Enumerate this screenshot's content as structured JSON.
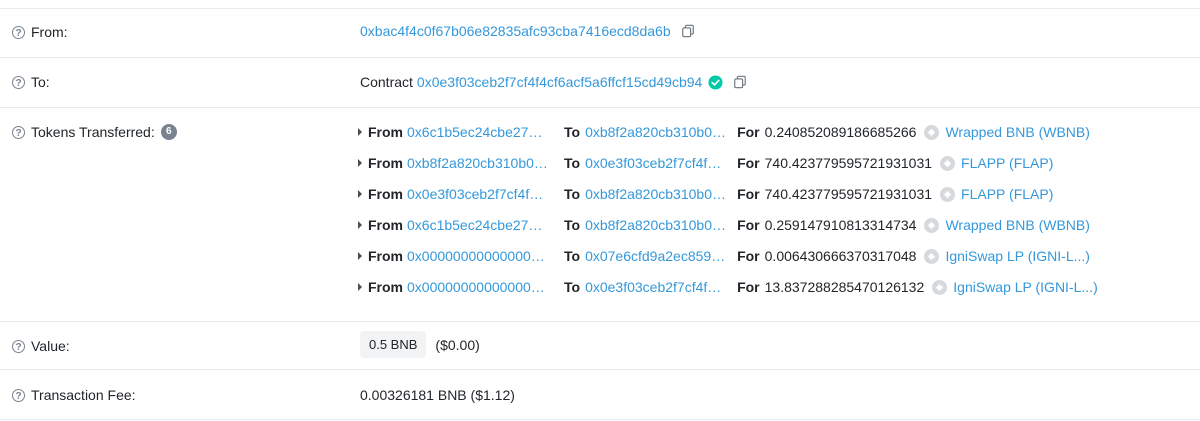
{
  "from": {
    "label": "From:",
    "address": "0xbac4f4c0f67b06e82835afc93cba7416ecd8da6b"
  },
  "to": {
    "label": "To:",
    "prefix": "Contract",
    "address": "0x0e3f03ceb2f7cf4f4cf6acf5a6ffcf15cd49cb94"
  },
  "tokens": {
    "label": "Tokens Transferred:",
    "count": "6",
    "kw_from": "From",
    "kw_to": "To",
    "kw_for": "For",
    "transfers": [
      {
        "from": "0x6c1b5ec24cbe27…",
        "to": "0xb8f2a820cb310b0…",
        "amount": "0.240852089186685266",
        "token": "Wrapped BNB (WBNB)"
      },
      {
        "from": "0xb8f2a820cb310b0…",
        "to": "0x0e3f03ceb2f7cf4f…",
        "amount": "740.423779595721931031",
        "token": "FLAPP (FLAP)"
      },
      {
        "from": "0x0e3f03ceb2f7cf4f…",
        "to": "0xb8f2a820cb310b0…",
        "amount": "740.423779595721931031",
        "token": "FLAPP (FLAP)"
      },
      {
        "from": "0x6c1b5ec24cbe27…",
        "to": "0xb8f2a820cb310b0…",
        "amount": "0.259147910813314734",
        "token": "Wrapped BNB (WBNB)"
      },
      {
        "from": "0x00000000000000…",
        "to": "0x07e6cfd9a2ec859…",
        "amount": "0.006430666370317048",
        "token": "IgniSwap LP (IGNI-L...)"
      },
      {
        "from": "0x00000000000000…",
        "to": "0x0e3f03ceb2f7cf4f…",
        "amount": "13.837288285470126132",
        "token": "IgniSwap LP (IGNI-L...)"
      }
    ]
  },
  "value": {
    "label": "Value:",
    "amount": "0.5 BNB",
    "usd": "($0.00)"
  },
  "fee": {
    "label": "Transaction Fee:",
    "amount": "0.00326181 BNB ($1.12)"
  },
  "colors": {
    "link": "#3498db",
    "verified": "#00c9a7",
    "muted": "#77838f"
  }
}
